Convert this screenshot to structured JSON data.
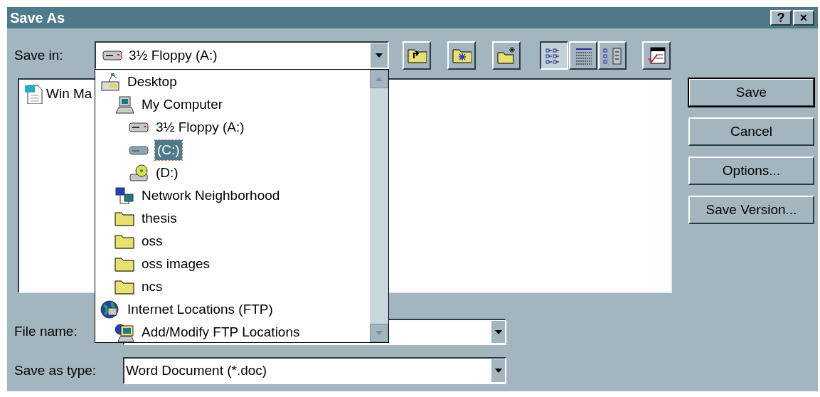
{
  "window": {
    "title": "Save As",
    "title_buttons": [
      "?",
      "×"
    ]
  },
  "save_in": {
    "label": "Save in:",
    "kind": "floppy",
    "value": "3½ Floppy (A:)"
  },
  "toolbar": [
    {
      "kind": "up-folder"
    },
    {
      "kind": "favorites-folder"
    },
    {
      "kind": "new-folder"
    },
    {
      "kind": "list-view",
      "selected": true
    },
    {
      "kind": "details-view",
      "selected": false
    },
    {
      "kind": "properties-view",
      "selected": false
    },
    {
      "kind": "commands"
    }
  ],
  "files": [
    {
      "kind": "word-doc",
      "name": "Win Ma"
    }
  ],
  "buttons": [
    {
      "label": "Save",
      "default": true
    },
    {
      "label": "Cancel",
      "default": false
    },
    {
      "label": "Options...",
      "default": false
    },
    {
      "label": "Save Version...",
      "default": false
    }
  ],
  "file_name": {
    "label": "File name:"
  },
  "save_as_type": {
    "label": "Save as type:",
    "value": "Word Document (*.doc)"
  },
  "dropdown": {
    "items": [
      {
        "kind": "desktop",
        "label": "Desktop",
        "selected": false,
        "children": [
          {
            "kind": "computer",
            "label": "My Computer",
            "selected": false,
            "children": [
              {
                "kind": "floppy",
                "label": "3½ Floppy (A:)",
                "selected": false
              },
              {
                "kind": "harddisk",
                "label": "(C:)",
                "selected": true
              },
              {
                "kind": "cdrom",
                "label": "(D:)",
                "selected": false
              }
            ]
          },
          {
            "kind": "network",
            "label": "Network Neighborhood",
            "selected": false
          },
          {
            "kind": "folder",
            "label": "thesis",
            "selected": false
          },
          {
            "kind": "folder",
            "label": "oss",
            "selected": false
          },
          {
            "kind": "folder",
            "label": "oss images",
            "selected": false
          },
          {
            "kind": "folder",
            "label": "ncs",
            "selected": false
          }
        ]
      },
      {
        "kind": "globe",
        "label": "Internet Locations (FTP)",
        "selected": false,
        "children": [
          {
            "kind": "ftp",
            "label": "Add/Modify FTP Locations",
            "selected": false
          }
        ]
      }
    ]
  }
}
